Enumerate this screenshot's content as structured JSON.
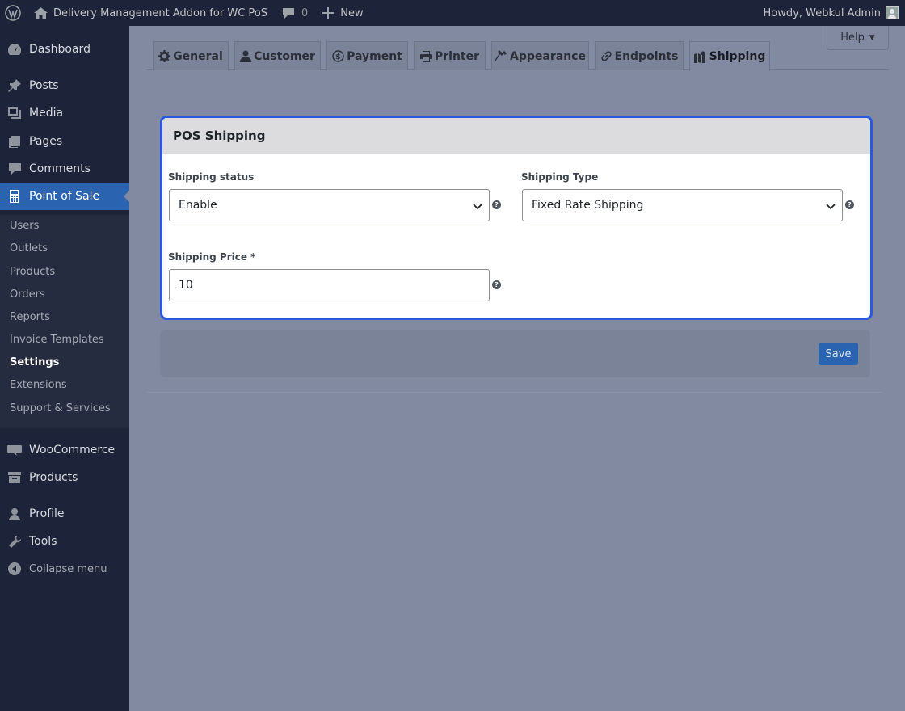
{
  "adminbar": {
    "site_name": "Delivery Management Addon for WC PoS",
    "comments_count": "0",
    "new_label": "New",
    "greeting": "Howdy, Webkul Admin"
  },
  "sidebar": {
    "dashboard": "Dashboard",
    "posts": "Posts",
    "media": "Media",
    "pages": "Pages",
    "comments": "Comments",
    "point_of_sale": "Point of Sale",
    "submenu": [
      "Users",
      "Outlets",
      "Products",
      "Orders",
      "Reports",
      "Invoice Templates",
      "Settings",
      "Extensions",
      "Support & Services"
    ],
    "woocommerce": "WooCommerce",
    "products": "Products",
    "profile": "Profile",
    "tools": "Tools",
    "collapse": "Collapse menu"
  },
  "tabs": [
    "General",
    "Customer",
    "Payment",
    "Printer",
    "Appearance",
    "Endpoints",
    "Shipping"
  ],
  "active_tab": "Shipping",
  "help_label": "Help",
  "panel": {
    "title": "POS Shipping",
    "shipping_status_label": "Shipping status",
    "shipping_status_value": "Enable",
    "shipping_type_label": "Shipping Type",
    "shipping_type_value": "Fixed Rate Shipping",
    "shipping_price_label": "Shipping Price *",
    "shipping_price_value": "10"
  },
  "save_label": "Save",
  "colors": {
    "sidebar_bg": "#1d2338",
    "accent": "#2a63b0",
    "card_border": "#2b58e0"
  }
}
